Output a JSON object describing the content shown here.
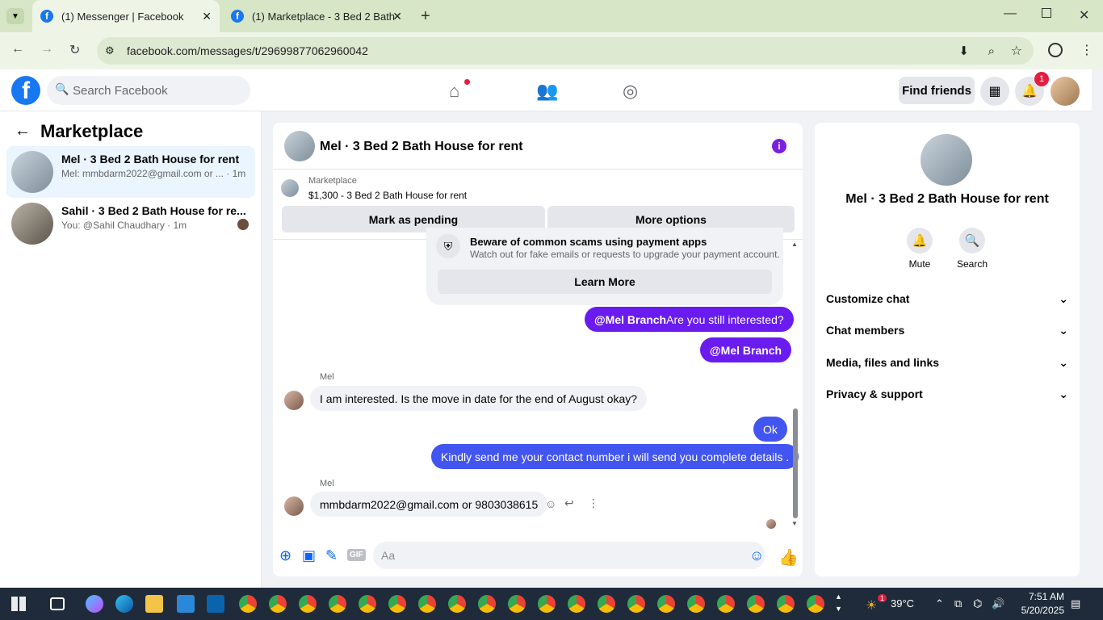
{
  "browser": {
    "tabs": [
      {
        "title": "(1) Messenger | Facebook",
        "active": true
      },
      {
        "title": "(1) Marketplace - 3 Bed 2 Bath",
        "active": false
      }
    ],
    "url": "facebook.com/messages/t/29699877062960042"
  },
  "header": {
    "search_placeholder": "Search Facebook",
    "find_friends": "Find friends",
    "notif_count": "1"
  },
  "left": {
    "title": "Marketplace",
    "conversations": [
      {
        "name": "Mel · 3 Bed 2 Bath House for rent",
        "preview": "Mel: mmbdarm2022@gmail.com or ...  · 1m"
      },
      {
        "name": "Sahil · 3 Bed 2 Bath House for re...",
        "preview": "You: @Sahil Chaudhary · 1m"
      }
    ]
  },
  "chat": {
    "title": "Mel · 3 Bed 2 Bath House for rent",
    "marketplace_label": "Marketplace",
    "listing": "$1,300 - 3 Bed 2 Bath House for rent",
    "mark_pending": "Mark as pending",
    "more_options": "More options",
    "warning_title": "Beware of common scams using payment apps",
    "warning_desc": "Watch out for fake emails or requests to upgrade your payment account.",
    "learn_more": "Learn More",
    "messages": [
      {
        "mention": "@Mel Branch",
        "text": " Are you still interested?"
      },
      {
        "mention": "@Mel Branch",
        "text": ""
      },
      {
        "sender": "Mel",
        "text": "I am interested. Is the move in date for the end of August okay?"
      },
      {
        "text": "Ok"
      },
      {
        "text": "Kindly send me your contact number i will send you complete details ."
      },
      {
        "sender": "Mel",
        "text": "mmbdarm2022@gmail.com or 9803038615"
      }
    ],
    "composer_placeholder": "Aa",
    "gif_label": "GIF"
  },
  "right": {
    "title": "Mel · 3 Bed 2 Bath House for rent",
    "mute": "Mute",
    "search": "Search",
    "items": [
      "Customize chat",
      "Chat members",
      "Media, files and links",
      "Privacy & support"
    ]
  },
  "taskbar": {
    "weather": "39°C",
    "weather_badge": "1",
    "time": "7:51 AM",
    "date": "5/20/2025"
  }
}
